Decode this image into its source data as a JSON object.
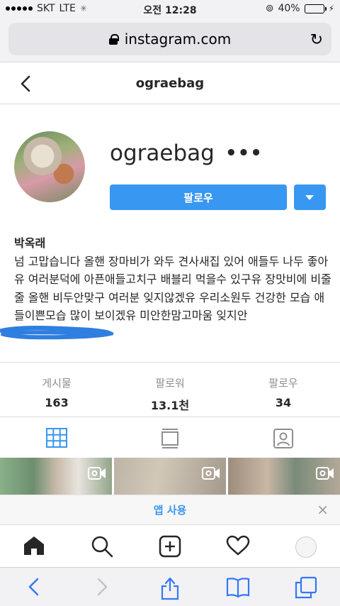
{
  "status_bar": {
    "carrier": "SKT",
    "network": "LTE",
    "time": "오전 12:28",
    "battery_pct": "40%",
    "battery_level": 0.4
  },
  "browser": {
    "url": "instagram.com"
  },
  "header": {
    "title": "ograebag"
  },
  "profile": {
    "username": "ograebag",
    "more": "•••",
    "follow_label": "팔로우",
    "name": "박옥래",
    "bio": "넘 고맙습니다 올핸 장마비가 와두 견사새집 있어 애들두 나두 좋아유 여러분덕에 아픈애들고치구 배블리 먹을수 있구유 장맛비에 비줄줄 올핸 비두안맞구 여러분 잊지않겠유 우리소원두 건강한 모습 애들이쁜모습 많이 보이겠유 미안한맘고마움 잊지안"
  },
  "stats": [
    {
      "label": "게시물",
      "value": "163"
    },
    {
      "label": "팔로워",
      "value": "13.1천"
    },
    {
      "label": "팔로우",
      "value": "34"
    }
  ],
  "app_banner": {
    "label": "앱 사용",
    "close": "×"
  },
  "colors": {
    "accent": "#3897f0",
    "scribble": "#2f7fe0"
  }
}
